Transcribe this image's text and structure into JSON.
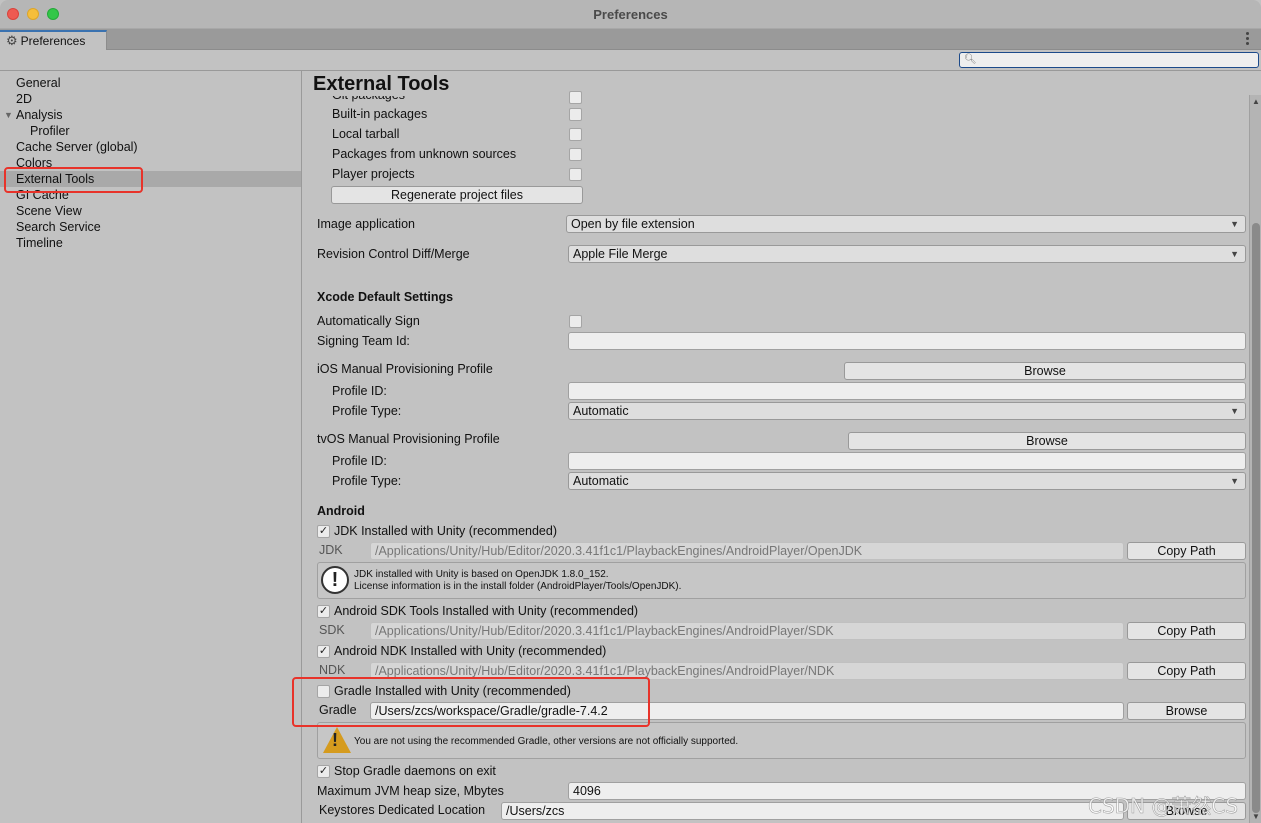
{
  "window": {
    "title": "Preferences",
    "tab_label": "Preferences"
  },
  "search": {
    "placeholder": "",
    "value": ""
  },
  "sidebar": {
    "items": [
      {
        "label": "General"
      },
      {
        "label": "2D"
      },
      {
        "label": "Analysis",
        "expanded": true
      },
      {
        "label": "Profiler",
        "sub": true
      },
      {
        "label": "Cache Server (global)"
      },
      {
        "label": "Colors"
      },
      {
        "label": "External Tools",
        "selected": true
      },
      {
        "label": "GI Cache"
      },
      {
        "label": "Scene View"
      },
      {
        "label": "Search Service"
      },
      {
        "label": "Timeline"
      }
    ]
  },
  "main": {
    "title": "External Tools",
    "generate_csproj": {
      "partial_label": "Git packages",
      "items": [
        {
          "label": "Built-in packages",
          "checked": false
        },
        {
          "label": "Local tarball",
          "checked": false
        },
        {
          "label": "Packages from unknown sources",
          "checked": false
        },
        {
          "label": "Player projects",
          "checked": false
        }
      ],
      "regenerate_button": "Regenerate project files"
    },
    "image_application": {
      "label": "Image application",
      "value": "Open by file extension"
    },
    "revision_control": {
      "label": "Revision Control Diff/Merge",
      "value": "Apple File Merge"
    },
    "xcode": {
      "heading": "Xcode Default Settings",
      "auto_sign_label": "Automatically Sign",
      "auto_sign_checked": false,
      "team_id_label": "Signing Team Id:",
      "team_id_value": "",
      "ios": {
        "label": "iOS Manual Provisioning Profile",
        "browse": "Browse",
        "profile_id_label": "Profile ID:",
        "profile_id_value": "",
        "profile_type_label": "Profile Type:",
        "profile_type_value": "Automatic"
      },
      "tvos": {
        "label": "tvOS Manual Provisioning Profile",
        "browse": "Browse",
        "profile_id_label": "Profile ID:",
        "profile_id_value": "",
        "profile_type_label": "Profile Type:",
        "profile_type_value": "Automatic"
      }
    },
    "android": {
      "heading": "Android",
      "jdk": {
        "checkbox_label": "JDK Installed with Unity (recommended)",
        "checked": true,
        "field_label": "JDK",
        "path": "/Applications/Unity/Hub/Editor/2020.3.41f1c1/PlaybackEngines/AndroidPlayer/OpenJDK",
        "button": "Copy Path",
        "info_line1": "JDK installed with Unity is based on OpenJDK 1.8.0_152.",
        "info_line2": "License information is in the install folder (AndroidPlayer/Tools/OpenJDK)."
      },
      "sdk": {
        "checkbox_label": "Android SDK Tools Installed with Unity (recommended)",
        "checked": true,
        "field_label": "SDK",
        "path": "/Applications/Unity/Hub/Editor/2020.3.41f1c1/PlaybackEngines/AndroidPlayer/SDK",
        "button": "Copy Path"
      },
      "ndk": {
        "checkbox_label": "Android NDK Installed with Unity (recommended)",
        "checked": true,
        "field_label": "NDK",
        "path": "/Applications/Unity/Hub/Editor/2020.3.41f1c1/PlaybackEngines/AndroidPlayer/NDK",
        "button": "Copy Path"
      },
      "gradle": {
        "checkbox_label": "Gradle Installed with Unity (recommended)",
        "checked": false,
        "field_label": "Gradle",
        "path": "/Users/zcs/workspace/Gradle/gradle-7.4.2",
        "button": "Browse",
        "warning": "You are not using the recommended Gradle, other versions are not officially supported."
      },
      "stop_gradle": {
        "label": "Stop Gradle daemons on exit",
        "checked": true
      },
      "jvm_heap": {
        "label": "Maximum JVM heap size, Mbytes",
        "value": "4096"
      },
      "keystores": {
        "label": "Keystores Dedicated Location",
        "value": "/Users/zcs",
        "button": "Browse"
      }
    }
  },
  "watermark": "CSDN @萧然CS",
  "colors": {
    "highlight": "#e8332a",
    "selection": "#a9a9a9",
    "accent": "#3a72b0"
  }
}
